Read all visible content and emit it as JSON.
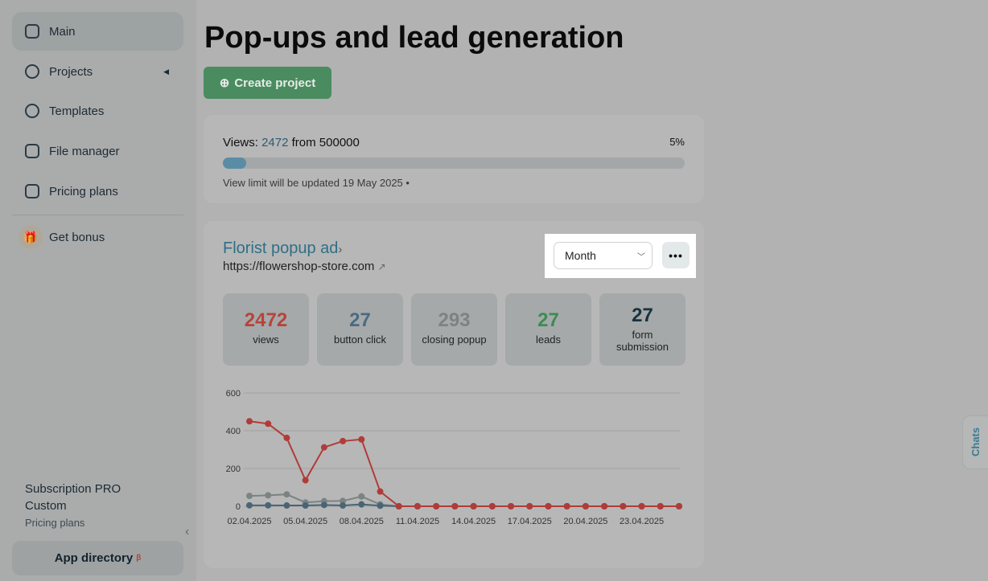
{
  "sidebar": {
    "items": [
      {
        "label": "Main",
        "icon": "sliders-icon"
      },
      {
        "label": "Projects",
        "icon": "projects-icon"
      },
      {
        "label": "Templates",
        "icon": "templates-icon"
      },
      {
        "label": "File manager",
        "icon": "file-icon"
      },
      {
        "label": "Pricing plans",
        "icon": "cards-icon"
      }
    ],
    "bonus": "Get bonus",
    "subscription": "Subscription PRO",
    "plan": "Custom",
    "pricing_link": "Pricing plans",
    "app_directory": "App directory",
    "beta": "β"
  },
  "page_title": "Pop-ups and lead generation",
  "create_button": "Create project",
  "views": {
    "label": "Views:",
    "count": "2472",
    "from": "from 500000",
    "percent": "5%",
    "progress": 0.05,
    "limit_note": "View limit will be updated 19 May 2025 •"
  },
  "project": {
    "title": "Florist popup ad",
    "url": "https://flowershop-store.com",
    "period": "Month",
    "more": "•••",
    "stats": [
      {
        "value": "2472",
        "label": "views",
        "color": "#b5443c"
      },
      {
        "value": "27",
        "label": "button click",
        "color": "#4a6b82"
      },
      {
        "value": "293",
        "label": "closing popup",
        "color": "#7e8282"
      },
      {
        "value": "27",
        "label": "leads",
        "color": "#3f8a55"
      },
      {
        "value": "27",
        "label": "form submission",
        "color": "#17323f"
      }
    ]
  },
  "chats": "Chats",
  "chart_data": {
    "type": "line",
    "ylim": [
      0,
      600
    ],
    "yticks": [
      "0",
      "200",
      "400",
      "600"
    ],
    "x": [
      "02.04.2025",
      "03.04.2025",
      "04.04.2025",
      "05.04.2025",
      "06.04.2025",
      "07.04.2025",
      "08.04.2025",
      "09.04.2025",
      "10.04.2025",
      "11.04.2025",
      "12.04.2025",
      "13.04.2025",
      "14.04.2025",
      "15.04.2025",
      "16.04.2025",
      "17.04.2025",
      "18.04.2025",
      "19.04.2025",
      "20.04.2025",
      "21.04.2025",
      "22.04.2025",
      "23.04.2025",
      "24.04.2025",
      "25.04.2025"
    ],
    "xtick_labels": [
      "02.04.2025",
      "05.04.2025",
      "08.04.2025",
      "11.04.2025",
      "14.04.2025",
      "17.04.2025",
      "20.04.2025",
      "23.04.2025"
    ],
    "series": [
      {
        "name": "closing popup",
        "color": "#7a8482",
        "values": [
          55,
          58,
          63,
          20,
          27,
          28,
          52,
          10,
          0,
          0,
          0,
          0,
          0,
          0,
          0,
          0,
          0,
          0,
          0,
          0,
          0,
          0,
          0,
          0
        ]
      },
      {
        "name": "button click",
        "color": "#4a6475",
        "values": [
          5,
          5,
          4,
          4,
          7,
          4,
          10,
          3,
          0,
          0,
          0,
          0,
          0,
          0,
          0,
          0,
          0,
          0,
          0,
          0,
          0,
          0,
          0,
          0
        ]
      },
      {
        "name": "views",
        "color": "#b03c38",
        "values": [
          450,
          437,
          362,
          138,
          312,
          345,
          354,
          78,
          0,
          0,
          0,
          0,
          0,
          0,
          0,
          0,
          0,
          0,
          0,
          0,
          0,
          0,
          0,
          0
        ]
      }
    ]
  }
}
